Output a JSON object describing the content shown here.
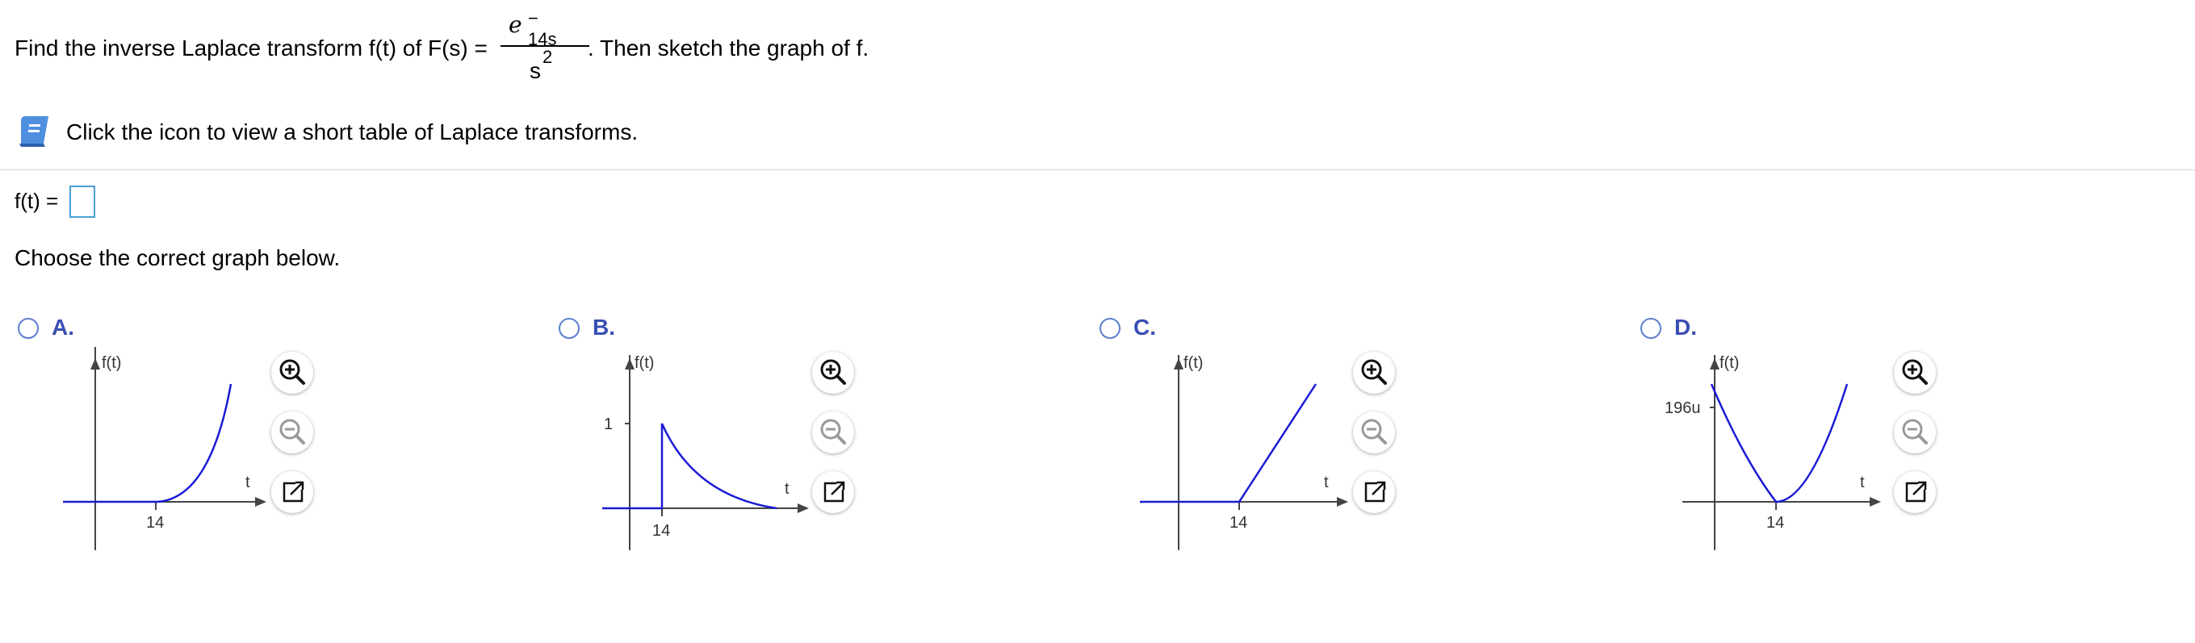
{
  "question": {
    "prefix": "Find the inverse Laplace transform f(t) of F(s) =",
    "numerator_base": "e",
    "numerator_exponent": "− 14s",
    "denominator_base": "s",
    "denominator_exponent": "2",
    "suffix": ". Then sketch the graph of f."
  },
  "table_link": {
    "text": "Click the icon to view a short table of Laplace transforms.",
    "icon": "book-icon"
  },
  "answer": {
    "label": "f(t) =",
    "value": ""
  },
  "choose_text": "Choose the correct graph below.",
  "options": [
    {
      "letter": "A.",
      "selected": false,
      "ylabel": "f(t)",
      "xlabel": "t",
      "xtick": "14",
      "ytick": ""
    },
    {
      "letter": "B.",
      "selected": false,
      "ylabel": "f(t)",
      "xlabel": "t",
      "xtick": "14",
      "ytick": "1"
    },
    {
      "letter": "C.",
      "selected": false,
      "ylabel": "f(t)",
      "xlabel": "t",
      "xtick": "14",
      "ytick": ""
    },
    {
      "letter": "D.",
      "selected": false,
      "ylabel": "f(t)",
      "xlabel": "t",
      "xtick": "14",
      "ytick": "196u"
    }
  ],
  "graph_controls": {
    "zoom_in_icon": "zoom-in-icon",
    "zoom_out_icon": "zoom-out-icon",
    "popout_icon": "popout-icon"
  },
  "colors": {
    "curve": "#1a1ad6",
    "radio": "#5a7fcc",
    "letter": "#3a4fb3",
    "answer_border": "#4a9fd6"
  }
}
